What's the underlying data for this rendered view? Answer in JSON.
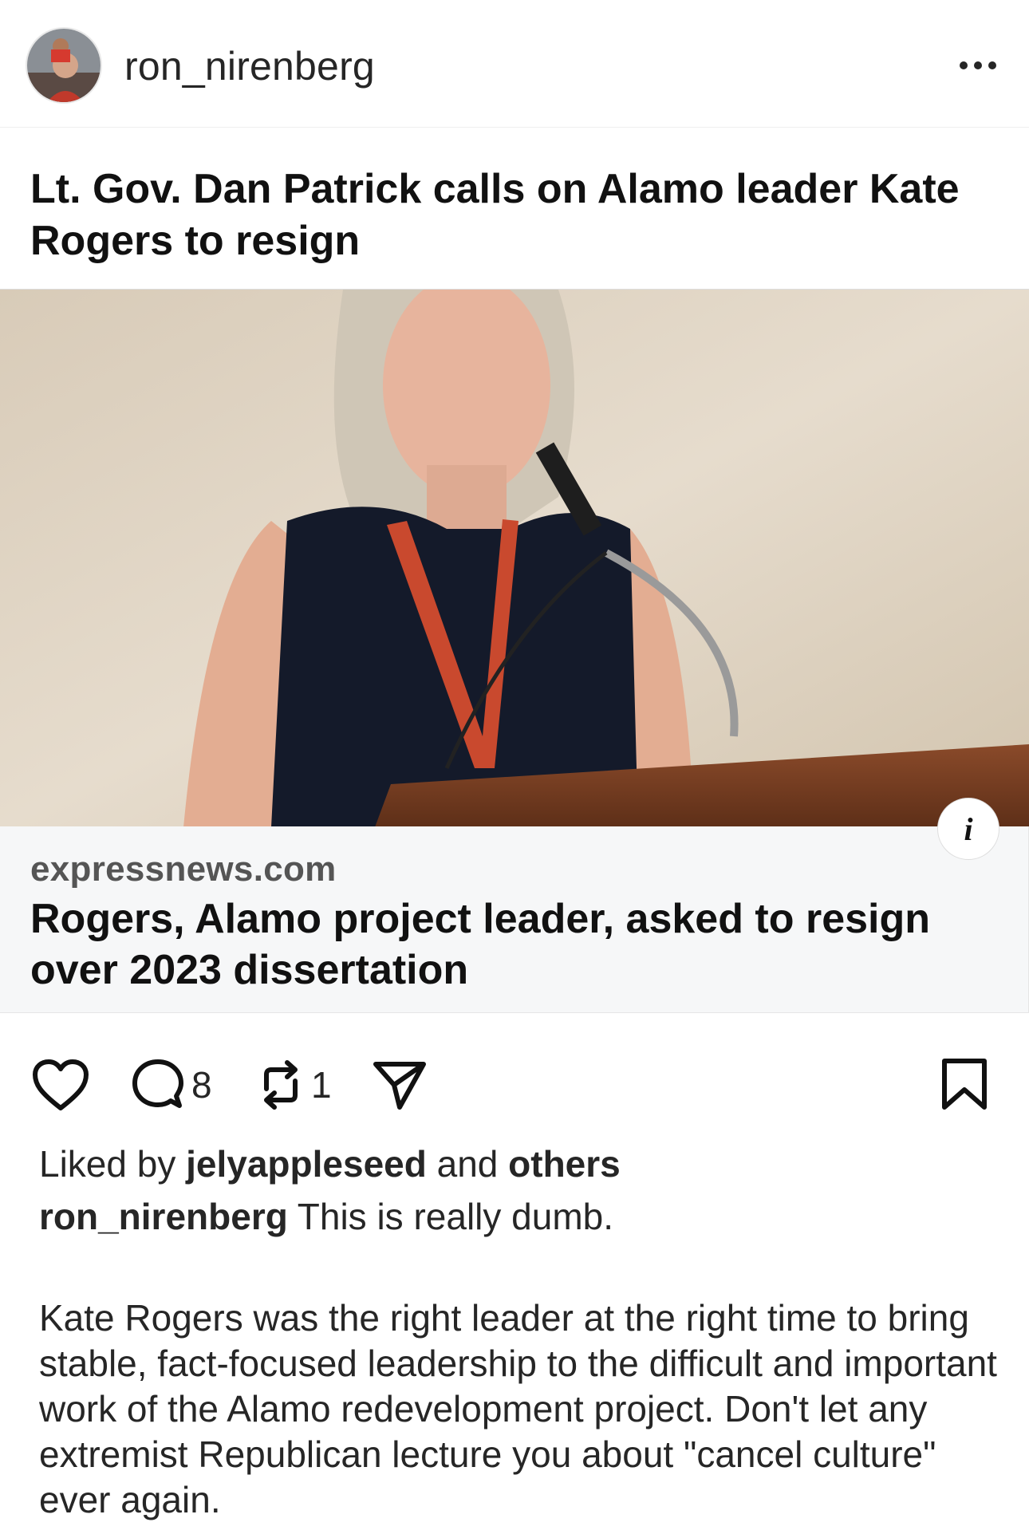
{
  "post": {
    "username": "ron_nirenberg",
    "title": "Lt. Gov. Dan Patrick calls on Alamo leader Kate Rogers to resign"
  },
  "link_card": {
    "domain": "expressnews.com",
    "headline": "Rogers, Alamo project leader, asked to resign over 2023 dissertation",
    "info_label": "i"
  },
  "actions": {
    "comments_count": "8",
    "reposts_count": "1"
  },
  "likes": {
    "prefix": "Liked by",
    "user": "jelyappleseed",
    "middle": "and",
    "others": "others"
  },
  "caption": {
    "user": "ron_nirenberg",
    "text": "This is really dumb.",
    "body": "Kate Rogers was the right leader at the right time to bring stable, fact-focused leadership to the difficult and important work of the Alamo redevelopment project. Don't let any extremist Republican lecture you about \"cancel culture\" ever again."
  }
}
